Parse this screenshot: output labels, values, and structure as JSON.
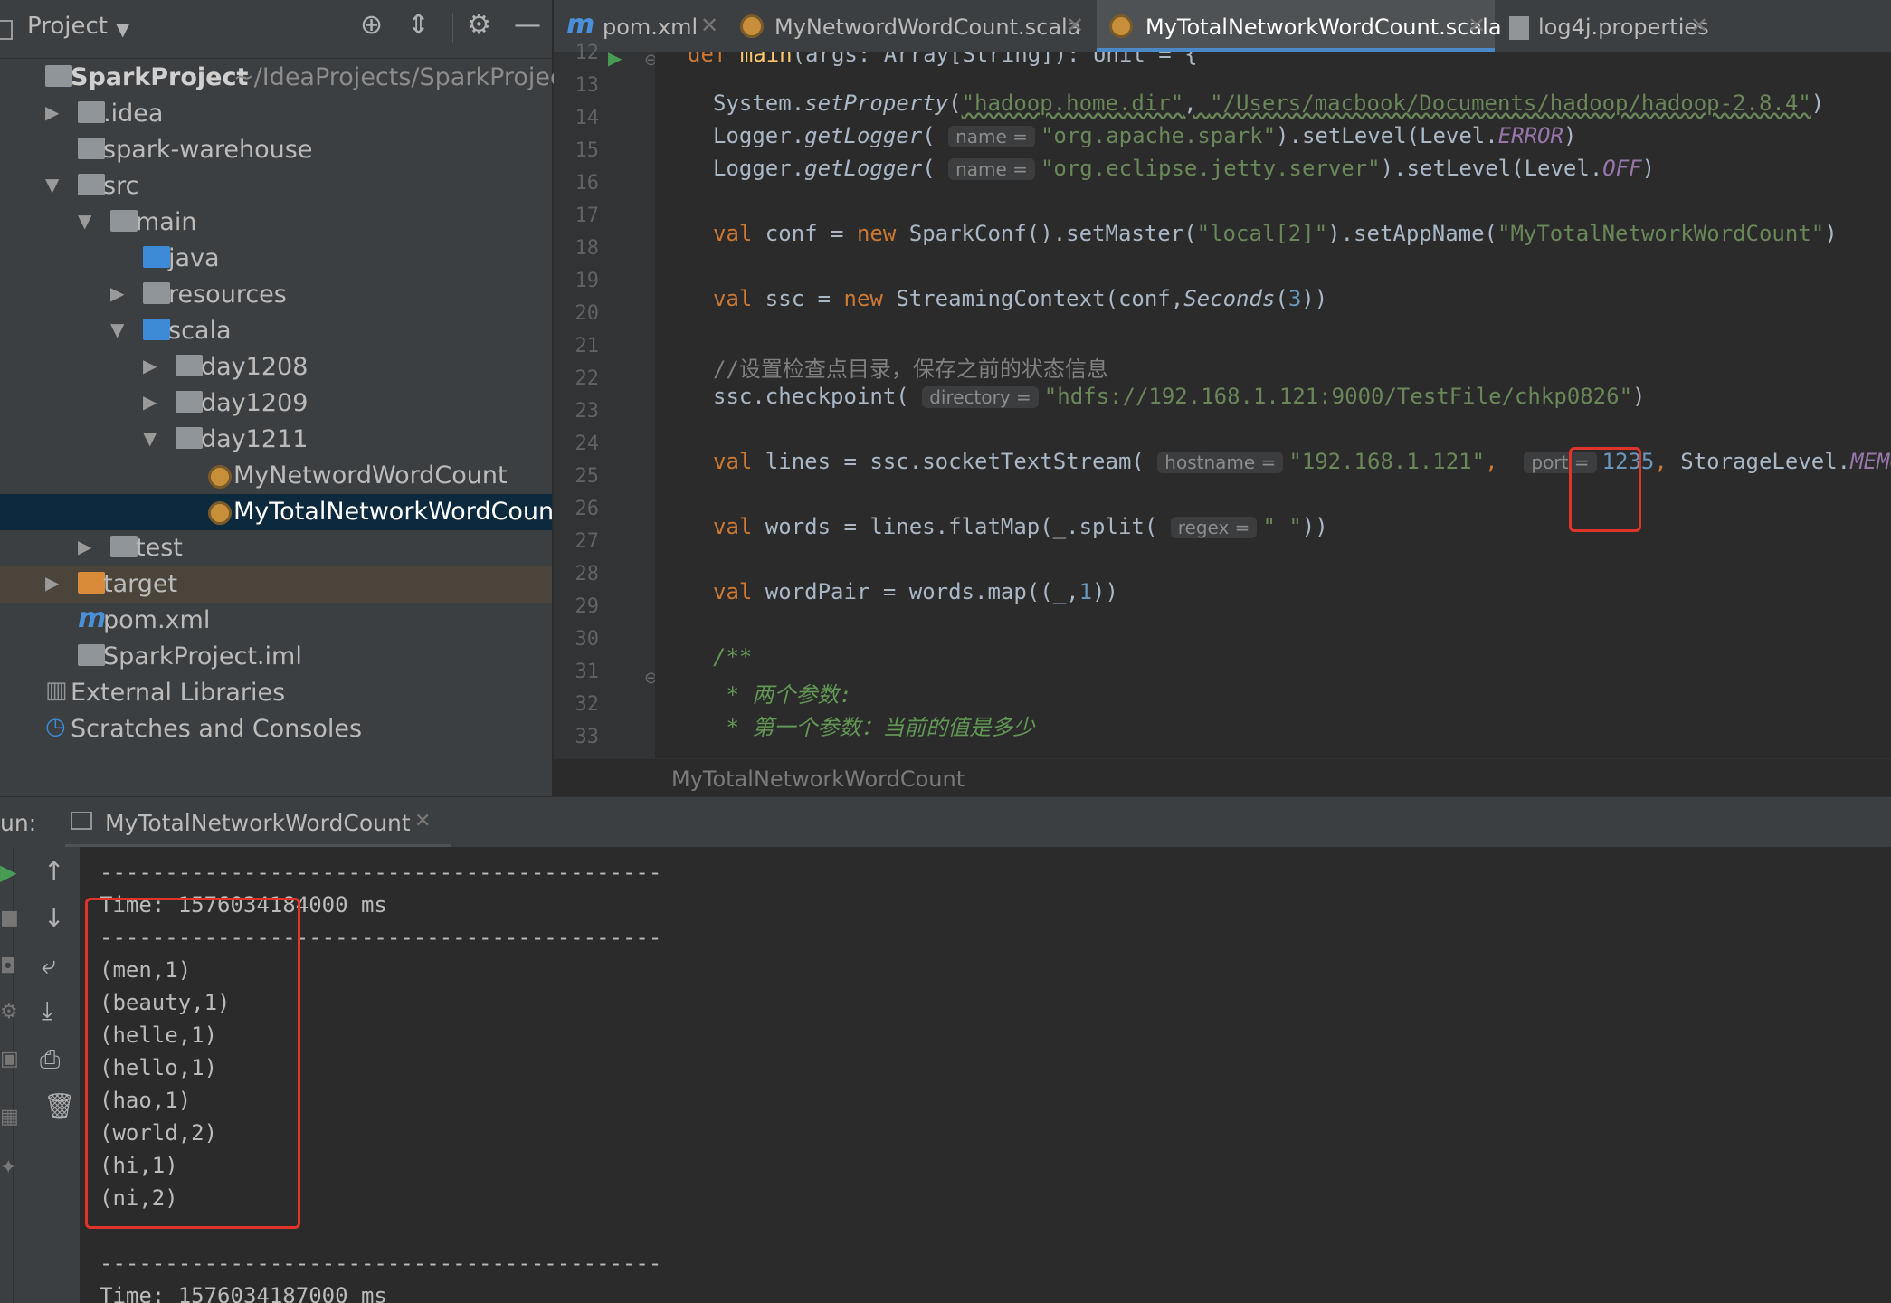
{
  "project_panel": {
    "title": "Project",
    "tree": [
      {
        "label": "SparkProject",
        "suffix": "~/IdeaProjects/SparkProject",
        "icon": "folder-icon",
        "arrow": "",
        "bold": true
      },
      {
        "label": ".idea",
        "icon": "folder-icon",
        "arrow": "▶"
      },
      {
        "label": "spark-warehouse",
        "icon": "folder-icon",
        "arrow": ""
      },
      {
        "label": "src",
        "icon": "folder-icon",
        "arrow": "▼"
      },
      {
        "label": "main",
        "icon": "folder-icon",
        "arrow": "▼"
      },
      {
        "label": "java",
        "icon": "source-folder-icon",
        "arrow": ""
      },
      {
        "label": "resources",
        "icon": "resources-folder-icon",
        "arrow": "▶"
      },
      {
        "label": "scala",
        "icon": "source-folder-icon",
        "arrow": "▼"
      },
      {
        "label": "day1208",
        "icon": "package-icon",
        "arrow": "▶"
      },
      {
        "label": "day1209",
        "icon": "package-icon",
        "arrow": "▶"
      },
      {
        "label": "day1211",
        "icon": "package-icon",
        "arrow": "▼"
      },
      {
        "label": "MyNetwordWordCount",
        "icon": "scala-object-icon",
        "arrow": ""
      },
      {
        "label": "MyTotalNetworkWordCount",
        "icon": "scala-object-icon",
        "arrow": "",
        "selected": true
      },
      {
        "label": "test",
        "icon": "folder-icon",
        "arrow": "▶"
      },
      {
        "label": "target",
        "icon": "excluded-folder-icon",
        "arrow": "▶",
        "highlight": true
      },
      {
        "label": "pom.xml",
        "icon": "maven-icon",
        "arrow": ""
      },
      {
        "label": "SparkProject.iml",
        "icon": "iml-file-icon",
        "arrow": ""
      },
      {
        "label": "External Libraries",
        "icon": "libraries-icon",
        "arrow": ""
      },
      {
        "label": "Scratches and Consoles",
        "icon": "scratches-icon",
        "arrow": ""
      }
    ]
  },
  "tabs": [
    {
      "label": "pom.xml",
      "icon": "m"
    },
    {
      "label": "MyNetwordWordCount.scala",
      "icon": "scala"
    },
    {
      "label": "MyTotalNetworkWordCount.scala",
      "icon": "scala",
      "active": true
    },
    {
      "label": "log4j.properties",
      "icon": "props"
    }
  ],
  "editor": {
    "line_numbers": [
      "12",
      "13",
      "14",
      "15",
      "16",
      "17",
      "18",
      "19",
      "20",
      "21",
      "22",
      "23",
      "24",
      "25",
      "26",
      "27",
      "28",
      "29",
      "30",
      "31",
      "32",
      "33"
    ],
    "line12": {
      "kw": "def",
      "name": "main",
      "rest": "(args: Array[String]): Unit = {"
    },
    "line14": {
      "obj": "System.",
      "method": "setProperty",
      "open": "(",
      "arg1": "\"hadoop.home.dir\"",
      "sep": ", ",
      "arg2": "\"/Users/macbook/Documents/hadoop/hadoop-2.8.4\"",
      "close": ")"
    },
    "line15": {
      "obj": "Logger.",
      "method": "getLogger",
      "open": "(",
      "hint": "name =",
      "arg": "\"org.apache.spark\"",
      "mid": ").setLevel(Level.",
      "level": "ERROR",
      "close": ")"
    },
    "line16": {
      "obj": "Logger.",
      "method": "getLogger",
      "open": "(",
      "hint": "name =",
      "arg": "\"org.eclipse.jetty.server\"",
      "mid": ").setLevel(Level.",
      "level": "OFF",
      "close": ")"
    },
    "line18": {
      "kw1": "val",
      "a": " conf = ",
      "kw2": "new",
      "b": " SparkConf().setMaster(",
      "s1": "\"local[2]\"",
      "c": ").setAppName(",
      "s2": "\"MyTotalNetworkWordCount\"",
      "d": ")"
    },
    "line20": {
      "kw1": "val",
      "a": " ssc = ",
      "kw2": "new",
      "b": " StreamingContext(conf,",
      "it": "Seconds",
      "c": "(",
      "num": "3",
      "d": "))"
    },
    "line22": {
      "comment": "//设置检查点目录，保存之前的状态信息"
    },
    "line23": {
      "a": "ssc.checkpoint(",
      "hint": "directory =",
      "s": "\"hdfs://192.168.1.121:9000/TestFile/chkp0826\"",
      "b": ")"
    },
    "line25": {
      "kw": "val",
      "a": " lines = ssc.socketTextStream(",
      "hint1": "hostname =",
      "s": "\"192.168.1.121\"",
      "sep": ",",
      "hint2": "port =",
      "num": "1235",
      "comma": ",",
      "b": " StorageLevel.",
      "c": "MEMORY_"
    },
    "line27": {
      "kw": "val",
      "a": " words = lines.flatMap(_.split(",
      "hint": "regex =",
      "s": "\" \"",
      "b": "))"
    },
    "line29": {
      "kw": "val",
      "a": " wordPair = words.map((_,",
      "num": "1",
      "b": "))"
    },
    "line31": {
      "doc": "/**"
    },
    "line32": {
      "doc": " * 两个参数:"
    },
    "line33": {
      "doc": " * 第一个参数：当前的值是多少"
    },
    "breadcrumb": "MyTotalNetworkWordCount"
  },
  "run": {
    "label": "un:",
    "tab": "MyTotalNetworkWordCount",
    "console": [
      "-------------------------------------------",
      "Time: 1576034184000 ms",
      "-------------------------------------------",
      "(men,1)",
      "(beauty,1)",
      "(helle,1)",
      "(hello,1)",
      "(hao,1)",
      "(world,2)",
      "(hi,1)",
      "(ni,2)",
      "",
      "-------------------------------------------",
      "Time: 1576034187000 ms"
    ]
  }
}
